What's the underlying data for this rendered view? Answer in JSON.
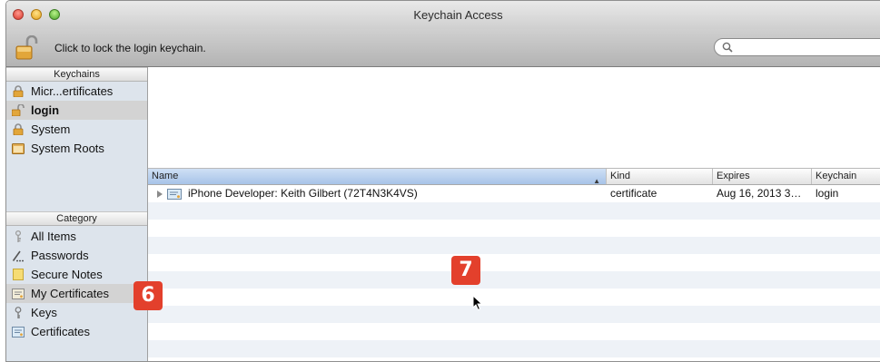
{
  "window": {
    "title": "Keychain Access"
  },
  "toolbar": {
    "lock_text": "Click to lock the login keychain.",
    "search_placeholder": ""
  },
  "sidebar": {
    "keychains_header": "Keychains",
    "keychains": [
      {
        "label": "Micr...ertificates",
        "icon": "lock-icon"
      },
      {
        "label": "login",
        "icon": "open-lock-icon",
        "selected": true
      },
      {
        "label": "System",
        "icon": "lock-icon"
      },
      {
        "label": "System Roots",
        "icon": "folder-icon"
      }
    ],
    "category_header": "Category",
    "categories": [
      {
        "label": "All Items",
        "icon": "all-items-icon"
      },
      {
        "label": "Passwords",
        "icon": "passwords-icon"
      },
      {
        "label": "Secure Notes",
        "icon": "secure-notes-icon"
      },
      {
        "label": "My Certificates",
        "icon": "certificate-icon",
        "selected": true
      },
      {
        "label": "Keys",
        "icon": "key-icon"
      },
      {
        "label": "Certificates",
        "icon": "certificate-icon"
      }
    ]
  },
  "table": {
    "columns": [
      "Name",
      "Kind",
      "Expires",
      "Keychain"
    ],
    "rows": [
      {
        "name": "iPhone Developer: Keith Gilbert (72T4N3K4VS)",
        "kind": "certificate",
        "expires": "Aug 16, 2013 3…",
        "keychain": "login"
      }
    ]
  },
  "callouts": {
    "six": "6",
    "seven": "7"
  },
  "colors": {
    "selection": "#d3d3d3",
    "sidebar_bg": "#dde4ec",
    "badge": "#e3402c"
  }
}
